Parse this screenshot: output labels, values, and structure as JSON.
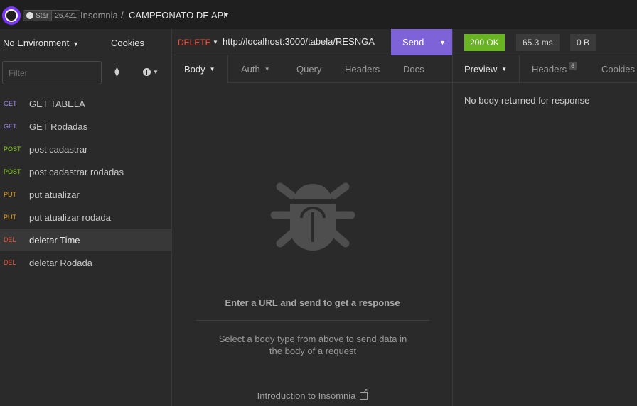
{
  "titlebar": {
    "star_label": "Star",
    "star_count": "26,421",
    "app_name": "Insomnia",
    "separator": "/",
    "workspace": "CAMPEONATO DE API",
    "logo_icon": "insomnia-logo",
    "github_icon": "github-icon"
  },
  "sidebar": {
    "environment": "No Environment",
    "cookies": "Cookies",
    "filter_placeholder": "Filter",
    "requests": [
      {
        "method": "GET",
        "name": "GET TABELA"
      },
      {
        "method": "GET",
        "name": "GET Rodadas"
      },
      {
        "method": "POST",
        "name": "post cadastrar"
      },
      {
        "method": "POST",
        "name": "post cadastrar rodadas"
      },
      {
        "method": "PUT",
        "name": "put atualizar"
      },
      {
        "method": "PUT",
        "name": "put atualizar rodada"
      },
      {
        "method": "DEL",
        "name": "deletar Time"
      },
      {
        "method": "DEL",
        "name": "deletar Rodada"
      }
    ],
    "active_index": 6
  },
  "request": {
    "method": "DELETE",
    "url": "http://localhost:3000/tabela/RESNGA",
    "send_label": "Send",
    "tabs": [
      "Body",
      "Auth",
      "Query",
      "Headers",
      "Docs"
    ],
    "empty_title": "Enter a URL and send to get a response",
    "empty_hint": "Select a body type from above to send data in the body of a request",
    "intro_link": "Introduction to Insomnia"
  },
  "response": {
    "status": "200 OK",
    "time": "65.3 ms",
    "size": "0 B",
    "tabs": {
      "preview": "Preview",
      "headers": "Headers",
      "headers_count": "6",
      "cookies": "Cookies"
    },
    "body_text": "No body returned for response"
  },
  "colors": {
    "accent": "#7e63d8",
    "status_ok": "#69b423",
    "get": "#a68cf2",
    "post": "#86d21e",
    "put": "#f0a020",
    "delete": "#f0533c"
  }
}
